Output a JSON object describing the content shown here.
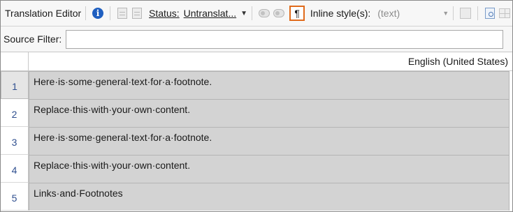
{
  "toolbar": {
    "title": "Translation Editor",
    "status_label": "Status:",
    "status_value": "Untranslat...",
    "pilcrow_symbol": "¶",
    "inline_style_label": "Inline style(s):",
    "inline_style_value": "(text)"
  },
  "filter": {
    "label": "Source Filter:",
    "value": ""
  },
  "grid": {
    "column_header": "English (United States)",
    "rows": [
      {
        "num": "1",
        "text": "Here·is·some·general·text·for·a·footnote."
      },
      {
        "num": "2",
        "text": "Replace·this·with·your·own·content."
      },
      {
        "num": "3",
        "text": "Here·is·some·general·text·for·a·footnote."
      },
      {
        "num": "4",
        "text": "Replace·this·with·your·own·content."
      },
      {
        "num": "5",
        "text": "Links·and·Footnotes"
      }
    ]
  },
  "colors": {
    "cell_bg": "#d3d3d3",
    "highlight_border": "#e06a1b",
    "info_blue": "#1f5fc0",
    "row_number": "#2f4f8f"
  },
  "icons": [
    "info-icon",
    "document-icon",
    "document-export-icon",
    "dropdown-caret-icon",
    "toggle-icon",
    "pilcrow-icon",
    "grey-action-icon",
    "preview-icon",
    "grid-icon"
  ]
}
